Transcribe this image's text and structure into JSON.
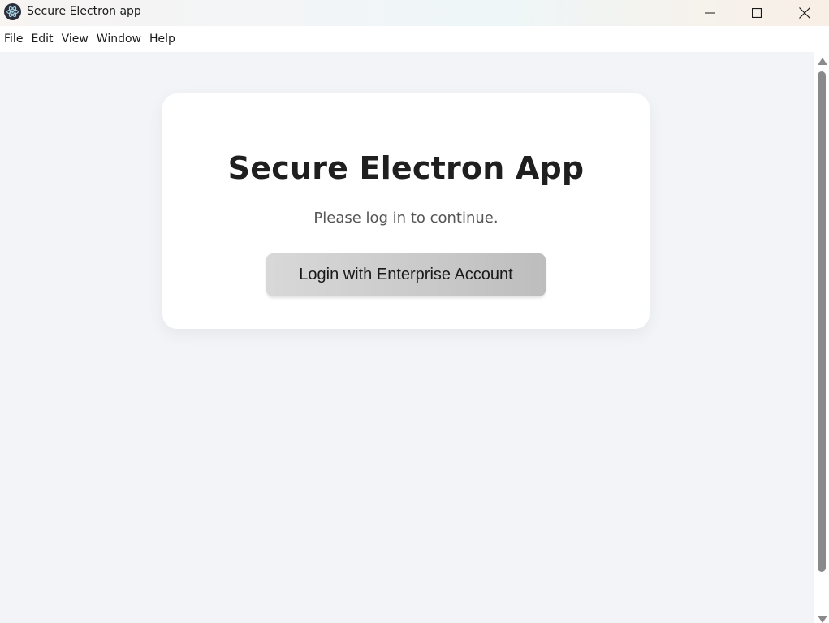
{
  "window": {
    "title": "Secure Electron app",
    "icon": "electron-logo-icon",
    "controls": [
      "minimize-icon",
      "maximize-icon",
      "close-icon"
    ]
  },
  "menu": {
    "items": [
      "File",
      "Edit",
      "View",
      "Window",
      "Help"
    ]
  },
  "login_card": {
    "title": "Secure Electron App",
    "subtitle": "Please log in to continue.",
    "login_button_label": "Login with Enterprise Account"
  },
  "colors": {
    "background": "#f3f4f8",
    "card": "#ffffff",
    "button_gradient_start": "#d8d8d8",
    "button_gradient_end": "#bdbdbd"
  }
}
